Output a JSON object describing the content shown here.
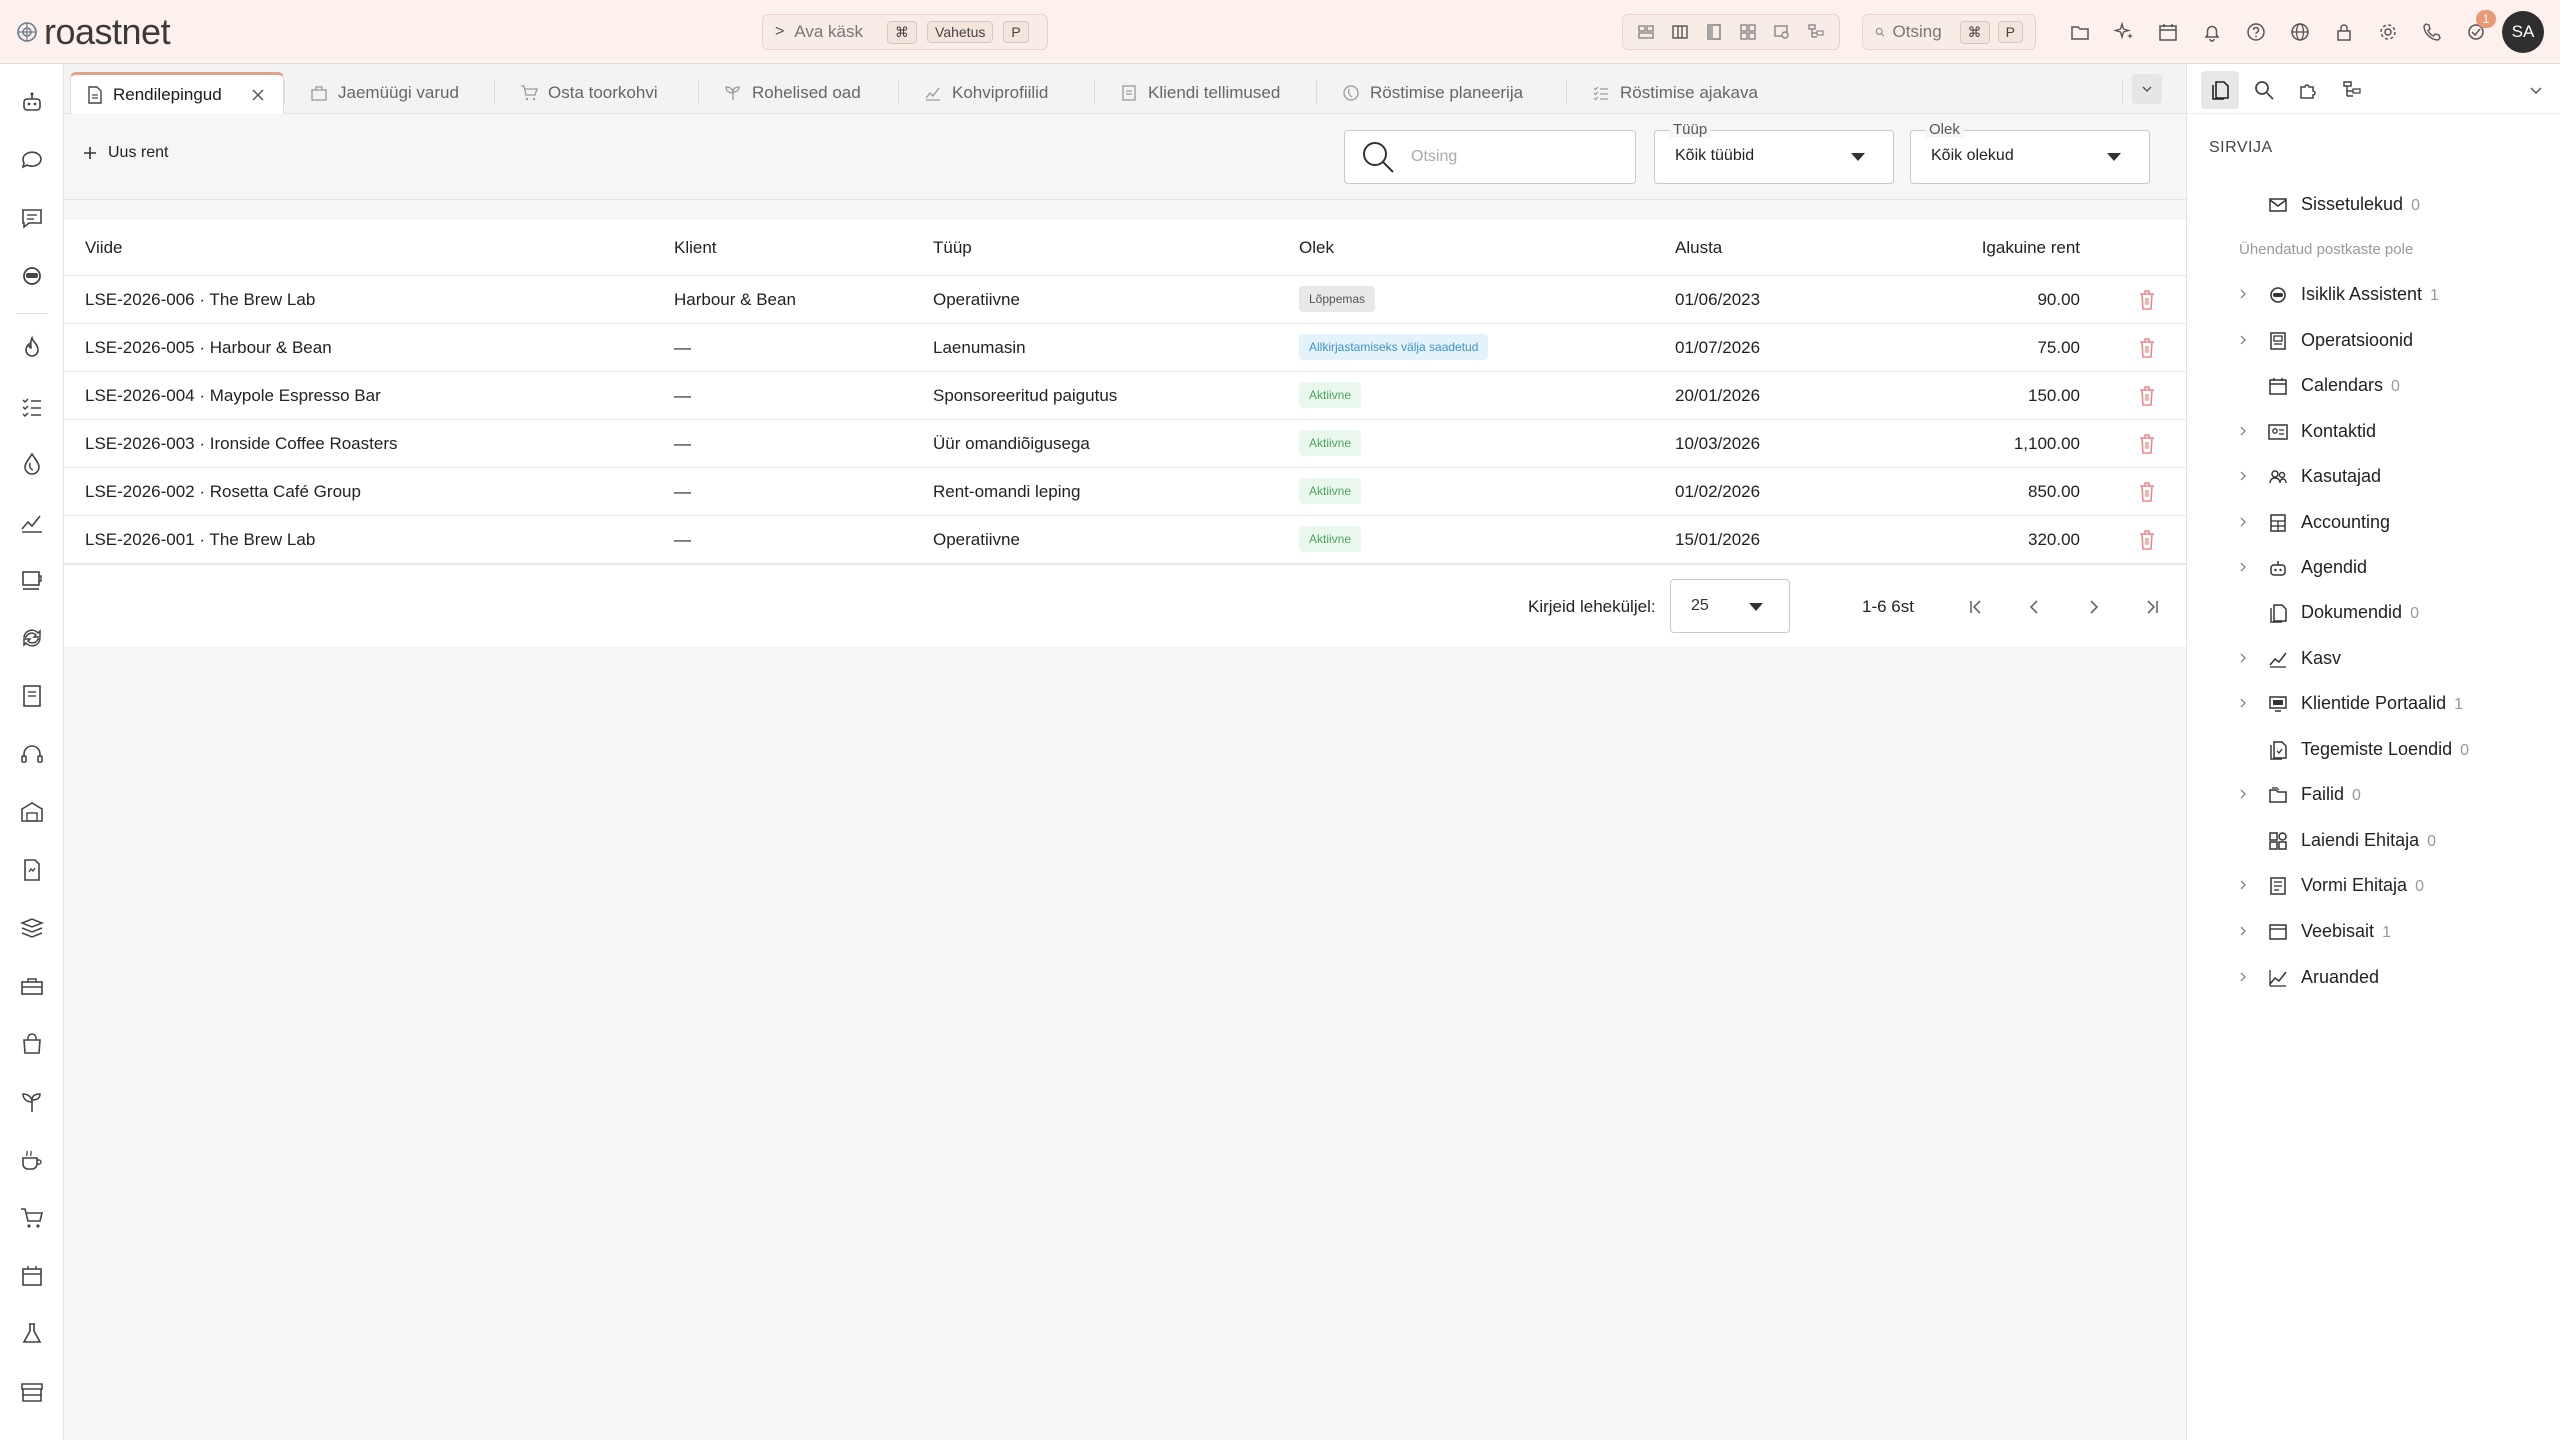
{
  "header": {
    "logo_text": "roastnet",
    "command": {
      "label": "Ava käsk",
      "kbd_cmd": "⌘",
      "kbd_shift": "Vahetus",
      "kbd_key": "P"
    },
    "search": {
      "label": "Otsing",
      "kbd_cmd": "⌘",
      "kbd_key": "P"
    },
    "notification_count": "1",
    "avatar_initials": "SA"
  },
  "tabs": [
    {
      "label": "Rendilepingud",
      "icon": "document-icon",
      "active": true
    },
    {
      "label": "Jaemüügi varud",
      "icon": "store-icon"
    },
    {
      "label": "Osta toorkohvi",
      "icon": "cart-icon"
    },
    {
      "label": "Rohelised oad",
      "icon": "sprout-icon"
    },
    {
      "label": "Kohviprofiilid",
      "icon": "chart-line-icon"
    },
    {
      "label": "Kliendi tellimused",
      "icon": "orders-icon"
    },
    {
      "label": "Röstimise planeerija",
      "icon": "roast-icon"
    },
    {
      "label": "Röstimise ajakava",
      "icon": "list-check-icon"
    }
  ],
  "toolbar": {
    "new_label": "Uus rent",
    "search_placeholder": "Otsing",
    "type_filter": {
      "label": "Tüüp",
      "value": "Kõik tüübid"
    },
    "status_filter": {
      "label": "Olek",
      "value": "Kõik olekud"
    }
  },
  "table": {
    "columns": {
      "ref": "Viide",
      "client": "Klient",
      "type": "Tüüp",
      "status": "Olek",
      "start": "Alusta",
      "rent": "Igakuine rent"
    },
    "rows": [
      {
        "ref": "LSE-2026-006 · The Brew Lab",
        "client": "Harbour & Bean",
        "type": "Operatiivne",
        "status": "Lõppemas",
        "status_kind": "ending",
        "start": "01/06/2023",
        "rent": "90.00"
      },
      {
        "ref": "LSE-2026-005 · Harbour & Bean",
        "client": "—",
        "type": "Laenumasin",
        "status": "Allkirjastamiseks välja saadetud",
        "status_kind": "signing",
        "start": "01/07/2026",
        "rent": "75.00"
      },
      {
        "ref": "LSE-2026-004 · Maypole Espresso Bar",
        "client": "—",
        "type": "Sponsoreeritud paigutus",
        "status": "Aktiivne",
        "status_kind": "active",
        "start": "20/01/2026",
        "rent": "150.00"
      },
      {
        "ref": "LSE-2026-003 · Ironside Coffee Roasters",
        "client": "—",
        "type": "Üür omandiõigusega",
        "status": "Aktiivne",
        "status_kind": "active",
        "start": "10/03/2026",
        "rent": "1,100.00"
      },
      {
        "ref": "LSE-2026-002 · Rosetta Café Group",
        "client": "—",
        "type": "Rent-omandi leping",
        "status": "Aktiivne",
        "status_kind": "active",
        "start": "01/02/2026",
        "rent": "850.00"
      },
      {
        "ref": "LSE-2026-001 · The Brew Lab",
        "client": "—",
        "type": "Operatiivne",
        "status": "Aktiivne",
        "status_kind": "active",
        "start": "15/01/2026",
        "rent": "320.00"
      }
    ]
  },
  "pagination": {
    "rows_per_page_label": "Kirjeid leheküljel:",
    "rows_per_page": "25",
    "range": "1-6 6st"
  },
  "right_panel": {
    "title": "SIRVIJA",
    "note": "Ühendatud postkaste pole",
    "items": [
      {
        "label": "Sissetulekud",
        "count": "0",
        "icon": "mail-icon",
        "expandable": false
      },
      {
        "label": "Isiklik Assistent",
        "count": "1",
        "icon": "assistant-icon",
        "expandable": true
      },
      {
        "label": "Operatsioonid",
        "count": "",
        "icon": "operations-icon",
        "expandable": true
      },
      {
        "label": "Calendars",
        "count": "0",
        "icon": "calendar-icon",
        "expandable": false
      },
      {
        "label": "Kontaktid",
        "count": "",
        "icon": "contact-card-icon",
        "expandable": true
      },
      {
        "label": "Kasutajad",
        "count": "",
        "icon": "users-icon",
        "expandable": true
      },
      {
        "label": "Accounting",
        "count": "",
        "icon": "calculator-icon",
        "expandable": true
      },
      {
        "label": "Agendid",
        "count": "",
        "icon": "robot-icon",
        "expandable": true
      },
      {
        "label": "Dokumendid",
        "count": "0",
        "icon": "documents-icon",
        "expandable": false
      },
      {
        "label": "Kasv",
        "count": "",
        "icon": "growth-chart-icon",
        "expandable": true
      },
      {
        "label": "Klientide Portaalid",
        "count": "1",
        "icon": "portal-icon",
        "expandable": true
      },
      {
        "label": "Tegemiste Loendid",
        "count": "0",
        "icon": "checklist-icon",
        "expandable": false
      },
      {
        "label": "Failid",
        "count": "0",
        "icon": "folder-icon",
        "expandable": true
      },
      {
        "label": "Laiendi Ehitaja",
        "count": "0",
        "icon": "extension-icon",
        "expandable": false
      },
      {
        "label": "Vormi Ehitaja",
        "count": "0",
        "icon": "form-icon",
        "expandable": true
      },
      {
        "label": "Veebisait",
        "count": "1",
        "icon": "browser-icon",
        "expandable": true
      },
      {
        "label": "Aruanded",
        "count": "",
        "icon": "report-chart-icon",
        "expandable": true
      }
    ]
  },
  "colors": {
    "accent": "#e3a38a",
    "topbar": "#fcf1ec",
    "danger": "#e88a8a",
    "active_status": "#4ea55e",
    "signing_status": "#3b95c8"
  }
}
